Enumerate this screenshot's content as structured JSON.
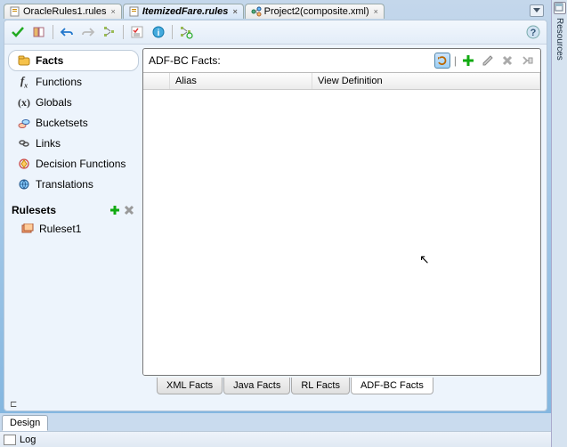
{
  "tabs": {
    "items": [
      {
        "label": "OracleRules1.rules",
        "active": false
      },
      {
        "label": "ItemizedFare.rules",
        "active": true
      },
      {
        "label": "Project2(composite.xml)",
        "active": false
      }
    ]
  },
  "dock": {
    "resources_label": "Resources"
  },
  "nav": {
    "items": [
      {
        "label": "Facts",
        "id": "facts"
      },
      {
        "label": "Functions",
        "id": "functions"
      },
      {
        "label": "Globals",
        "id": "globals"
      },
      {
        "label": "Bucketsets",
        "id": "bucketsets"
      },
      {
        "label": "Links",
        "id": "links"
      },
      {
        "label": "Decision Functions",
        "id": "decision-functions"
      },
      {
        "label": "Translations",
        "id": "translations"
      }
    ],
    "section_label": "Rulesets",
    "sub_items": [
      {
        "label": "Ruleset1"
      }
    ]
  },
  "main": {
    "header": "ADF-BC Facts:",
    "columns": {
      "alias": "Alias",
      "view": "View Definition"
    }
  },
  "bottom_tabs": {
    "items": [
      {
        "label": "XML Facts",
        "active": false
      },
      {
        "label": "Java Facts",
        "active": false
      },
      {
        "label": "RL Facts",
        "active": false
      },
      {
        "label": "ADF-BC Facts",
        "active": true
      }
    ]
  },
  "view_tabs": {
    "design": "Design",
    "log": "Log"
  }
}
